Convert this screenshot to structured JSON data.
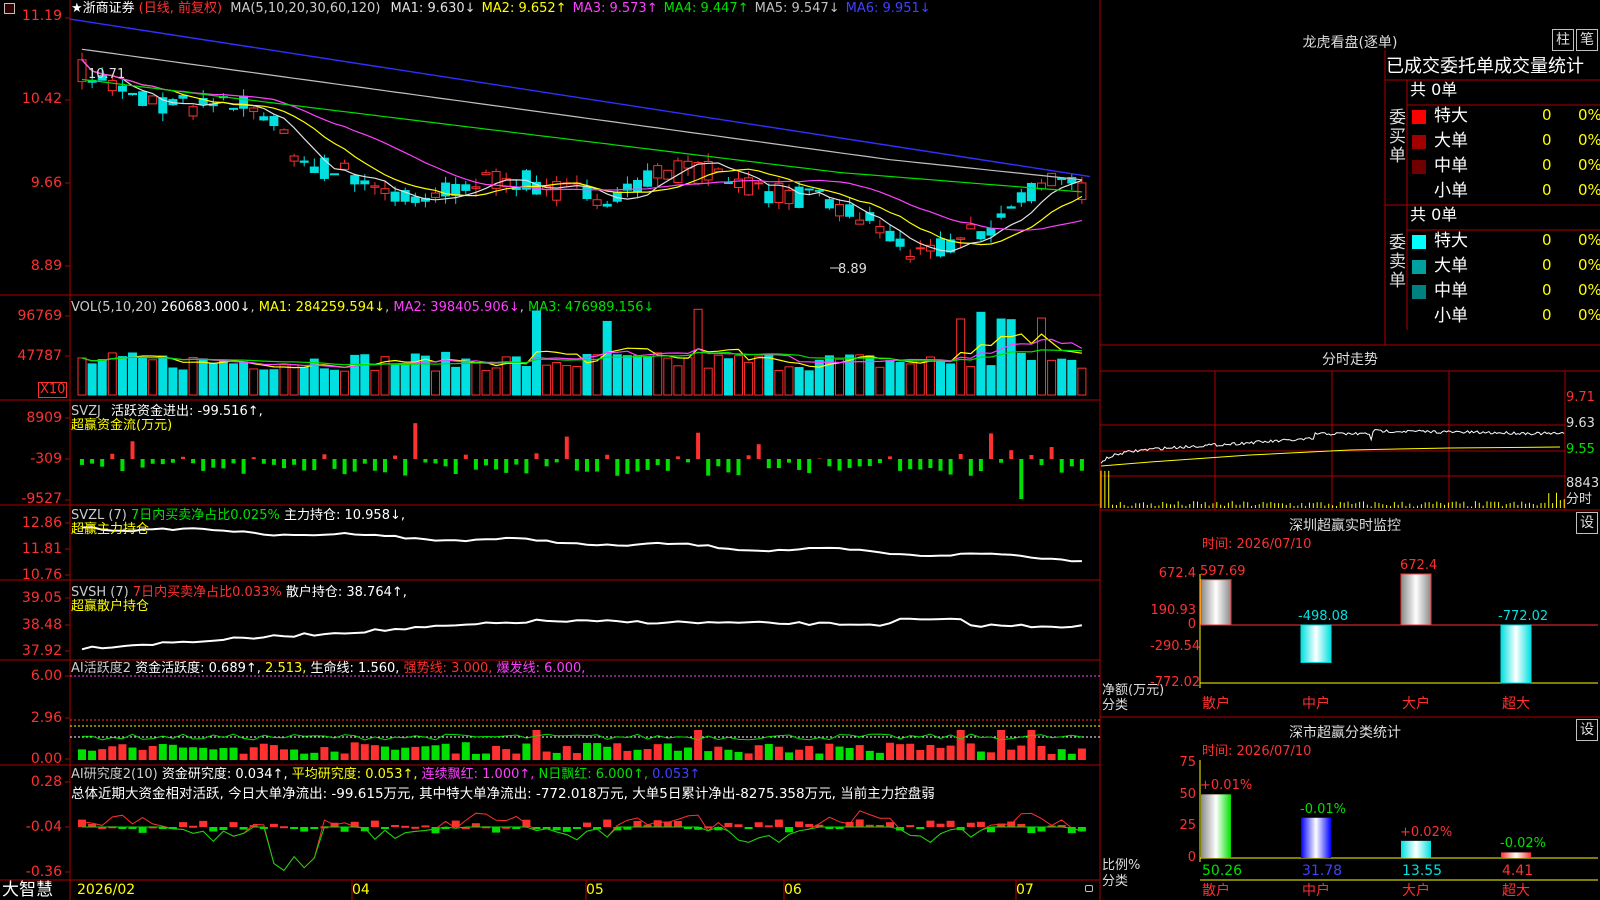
{
  "app": {
    "name": "大智慧"
  },
  "stock": {
    "name": "浙商证券",
    "star": "★",
    "mode": "(日线, 前复权)"
  },
  "main_chart": {
    "ma_header": "MA(5,10,20,30,60,120)",
    "ma_values": [
      {
        "label": "MA1:",
        "value": "9.630↓",
        "color": "#e0e0e0"
      },
      {
        "label": "MA2:",
        "value": "9.652↑",
        "color": "#ffff00"
      },
      {
        "label": "MA3:",
        "value": "9.573↑",
        "color": "#ff40ff"
      },
      {
        "label": "MA4:",
        "value": "9.447↑",
        "color": "#00e000"
      },
      {
        "label": "MA5:",
        "value": "9.547↓",
        "color": "#c0c0c0"
      },
      {
        "label": "MA6:",
        "value": "9.951↓",
        "color": "#4040ff"
      }
    ],
    "y_ticks": [
      "11.19",
      "10.42",
      "9.66",
      "8.89"
    ],
    "y_values": [
      11.19,
      10.42,
      9.66,
      8.89
    ],
    "high_label": "10.71",
    "low_label": "8.89"
  },
  "volume_panel": {
    "header": "VOL(5,10,20)",
    "value": "260683.000↓",
    "ma1": "MA1: 284259.594↓",
    "ma2": "MA2: 398405.906↓",
    "ma3": "MA3: 476989.156↓",
    "y_ticks": [
      "96769",
      "47787"
    ],
    "unit": "X10"
  },
  "svzj_panel": {
    "header": "SVZJ",
    "label": "活跃资金进出: -99.516↑,",
    "subtitle": "超赢资金流(万元)",
    "y_ticks": [
      "8909",
      "-309",
      "-9527"
    ]
  },
  "svzl_panel": {
    "header": "SVZL (7)",
    "label1": "7日内买卖净占比0.025%",
    "label2": "主力持仓: 10.958↓,",
    "subtitle": "超赢主力持仓",
    "y_ticks": [
      "12.86",
      "11.81",
      "10.76"
    ]
  },
  "svsh_panel": {
    "header": "SVSH (7)",
    "label1": "7日内买卖净占比0.033%",
    "label2": "散户持仓: 38.764↑,",
    "subtitle": "超赢散户持仓",
    "y_ticks": [
      "39.05",
      "38.48",
      "37.92"
    ]
  },
  "ai_active_panel": {
    "header": "AI活跃度2",
    "label1": "资金活跃度: 0.689↑,",
    "label2": "2.513,",
    "label3": "生命线: 1.560,",
    "label4": "强势线: 3.000,",
    "label5": "爆发线: 6.000,",
    "y_ticks": [
      "6.00",
      "2.96",
      "0.00"
    ]
  },
  "ai_research_panel": {
    "header": "AI研究度2(10)",
    "label1": "资金研究度: 0.034↑,",
    "label2": "平均研究度: 0.053↑,",
    "label3": "连续飘红: 1.000↑,",
    "label4": "N日飘红: 6.000↑,",
    "label5": "0.053↑",
    "summary": "总体近期大资金相对活跃, 今日大单净流出: -99.615万元, 其中特大单净流出: -772.018万元, 大单5日累计净出-8275.358万元, 当前主力控盘弱",
    "y_ticks": [
      "0.28",
      "-0.04",
      "-0.36"
    ]
  },
  "x_axis": {
    "labels": [
      "2026/02",
      "04",
      "05",
      "06",
      "07"
    ]
  },
  "right_panel": {
    "title": "龙虎看盘(逐单)",
    "btn_column": "柱",
    "btn_pen": "笔",
    "subtitle": "已成交委托单成交量统计",
    "buy_group": {
      "label": "委买单",
      "total": "共 0单",
      "rows": [
        {
          "name": "特大",
          "count": "0",
          "pct": "0%",
          "color": "#ff0000"
        },
        {
          "name": "大单",
          "count": "0",
          "pct": "0%",
          "color": "#a00000"
        },
        {
          "name": "中单",
          "count": "0",
          "pct": "0%",
          "color": "#700000"
        },
        {
          "name": "小单",
          "count": "0",
          "pct": "0%",
          "color": "#000000"
        }
      ]
    },
    "sell_group": {
      "label": "委卖单",
      "total": "共 0单",
      "rows": [
        {
          "name": "特大",
          "count": "0",
          "pct": "0%",
          "color": "#00ffff"
        },
        {
          "name": "大单",
          "count": "0",
          "pct": "0%",
          "color": "#00a0a0"
        },
        {
          "name": "中单",
          "count": "0",
          "pct": "0%",
          "color": "#008080"
        },
        {
          "name": "小单",
          "count": "0",
          "pct": "0%",
          "color": "#000000"
        }
      ]
    },
    "intraday": {
      "title": "分时走势",
      "y_ticks": [
        "9.71",
        "9.63",
        "9.55"
      ],
      "vol_label": "8843",
      "vol_unit": "分时"
    },
    "sz_monitor": {
      "title": "深圳超赢实时监控",
      "btn": "设",
      "time": "时间: 2026/07/10",
      "y_ticks": [
        "672.4",
        "190.93",
        "0",
        "-290.54",
        "-772.02"
      ],
      "axis_label1": "净额(万元)",
      "axis_label2": "分类",
      "categories": [
        "散户",
        "中户",
        "大户",
        "超大"
      ],
      "values": [
        597.69,
        -498.08,
        672.4,
        -772.02
      ],
      "value_labels": [
        "597.69",
        "-498.08",
        "672.4",
        "-772.02"
      ]
    },
    "sz_class": {
      "title": "深市超赢分类统计",
      "btn": "设",
      "time": "时间: 2026/07/10",
      "y_ticks": [
        "75",
        "50",
        "25",
        "0"
      ],
      "axis_label1": "比例%",
      "axis_label2": "分类",
      "categories": [
        "散户",
        "中户",
        "大户",
        "超大"
      ],
      "values": [
        50.26,
        31.78,
        13.55,
        4.41
      ],
      "change_labels": [
        "+0.01%",
        "-0.01%",
        "+0.02%",
        "-0.02%"
      ],
      "value_labels": [
        "50.26",
        "31.78",
        "13.55",
        "4.41"
      ]
    }
  },
  "colors": {
    "up": "#ff3030",
    "down": "#00e0e0",
    "grid": "#a00000"
  },
  "chart_data": [
    {
      "type": "bar",
      "title": "深圳超赢实时监控",
      "categories": [
        "散户",
        "中户",
        "大户",
        "超大"
      ],
      "values": [
        597.69,
        -498.08,
        672.4,
        -772.02
      ],
      "ylabel": "净额(万元)",
      "ylim": [
        -772.02,
        672.4
      ]
    },
    {
      "type": "bar",
      "title": "深市超赢分类统计",
      "categories": [
        "散户",
        "中户",
        "大户",
        "超大"
      ],
      "values": [
        50.26,
        31.78,
        13.55,
        4.41
      ],
      "ylabel": "比例%",
      "ylim": [
        0,
        75
      ]
    }
  ]
}
